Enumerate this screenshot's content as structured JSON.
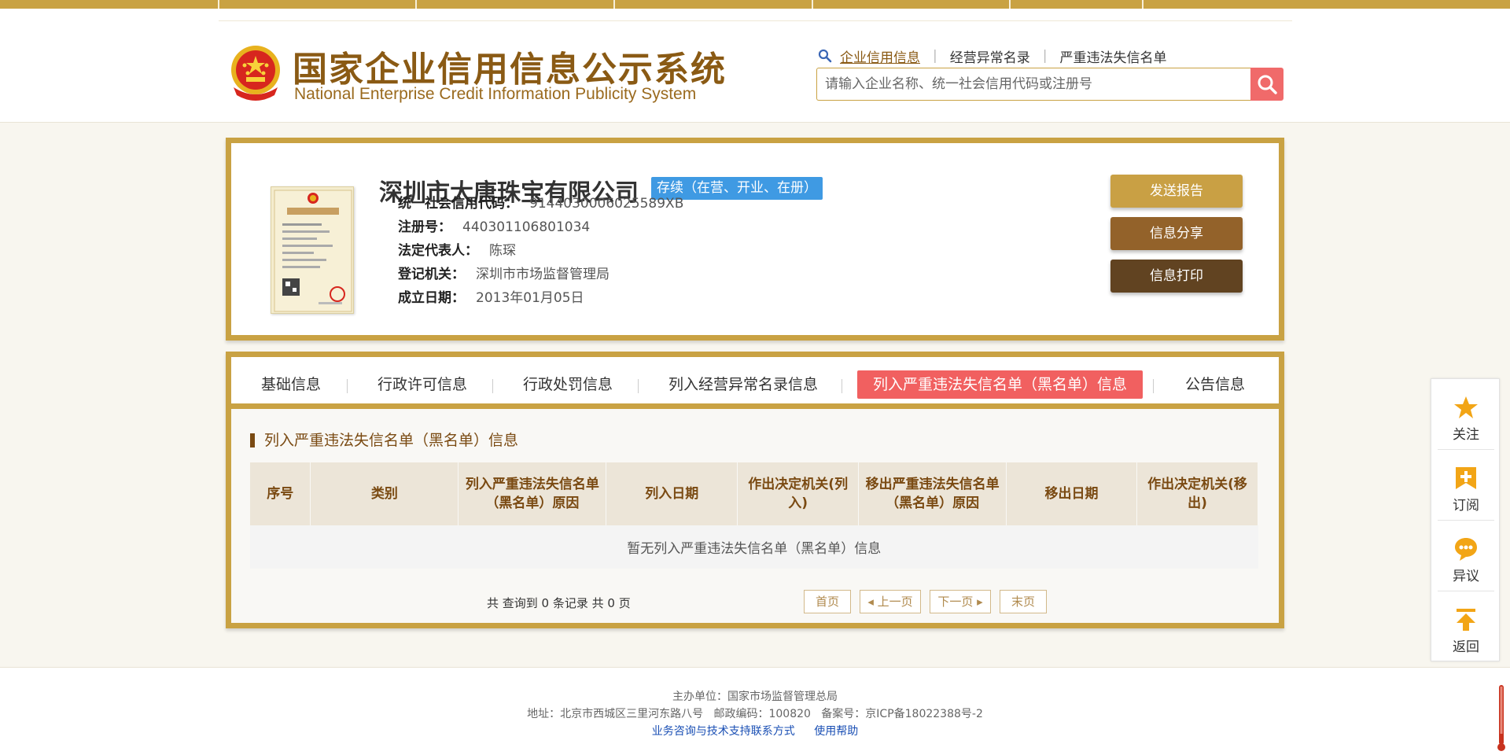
{
  "site": {
    "title_cn": "国家企业信用信息公示系统",
    "title_en": "National Enterprise Credit Information Publicity System"
  },
  "topnav": {
    "items": [
      "企业信用信息",
      "经营异常名录",
      "严重违法失信名单"
    ],
    "active_index": 0
  },
  "search": {
    "placeholder": "请输入企业名称、统一社会信用代码或注册号"
  },
  "company": {
    "name": "深圳市大唐珠宝有限公司",
    "status": "存续（在营、开业、在册）",
    "fields": [
      {
        "label": "统一社会信用代码：",
        "value": "9144030006025589XB"
      },
      {
        "label": "注册号：",
        "value": "440301106801034"
      },
      {
        "label": "法定代表人：",
        "value": "陈琛"
      },
      {
        "label": "登记机关：",
        "value": "深圳市市场监督管理局"
      },
      {
        "label": "成立日期：",
        "value": "2013年01月05日"
      }
    ]
  },
  "actions": {
    "send_report": "发送报告",
    "share": "信息分享",
    "print": "信息打印"
  },
  "tabs": {
    "items": [
      "基础信息",
      "行政许可信息",
      "行政处罚信息",
      "列入经营异常名录信息",
      "列入严重违法失信名单（黑名单）信息",
      "公告信息"
    ],
    "active_index": 4
  },
  "section": {
    "title": "列入严重违法失信名单（黑名单）信息"
  },
  "table": {
    "headers": [
      "序号",
      "类别",
      "列入严重违法失信名单（黑名单）原因",
      "列入日期",
      "作出决定机关(列入)",
      "移出严重违法失信名单（黑名单）原因",
      "移出日期",
      "作出决定机关(移出)"
    ],
    "empty_message": "暂无列入严重违法失信名单（黑名单）信息"
  },
  "pager": {
    "summary": "共 查询到 0 条记录 共 0 页",
    "first": "首页",
    "prev": "上一页",
    "next": "下一页",
    "last": "末页"
  },
  "float_toolbar": {
    "follow": "关注",
    "subscribe": "订阅",
    "objection": "异议",
    "back": "返回"
  },
  "footer": {
    "sponsor": "主办单位：国家市场监督管理总局",
    "address": "地址：北京市西城区三里河东路八号   邮政编码：100820   备案号：京ICP备18022388号-2",
    "link_support": "业务咨询与技术支持联系方式",
    "link_help": "使用帮助"
  },
  "colors": {
    "gold": "#c9a243",
    "brown": "#7a4a12",
    "active_tab": "#f16060",
    "status_badge": "#3f9ae3",
    "search_button": "#f06a6a",
    "link": "#1a4fb4"
  }
}
